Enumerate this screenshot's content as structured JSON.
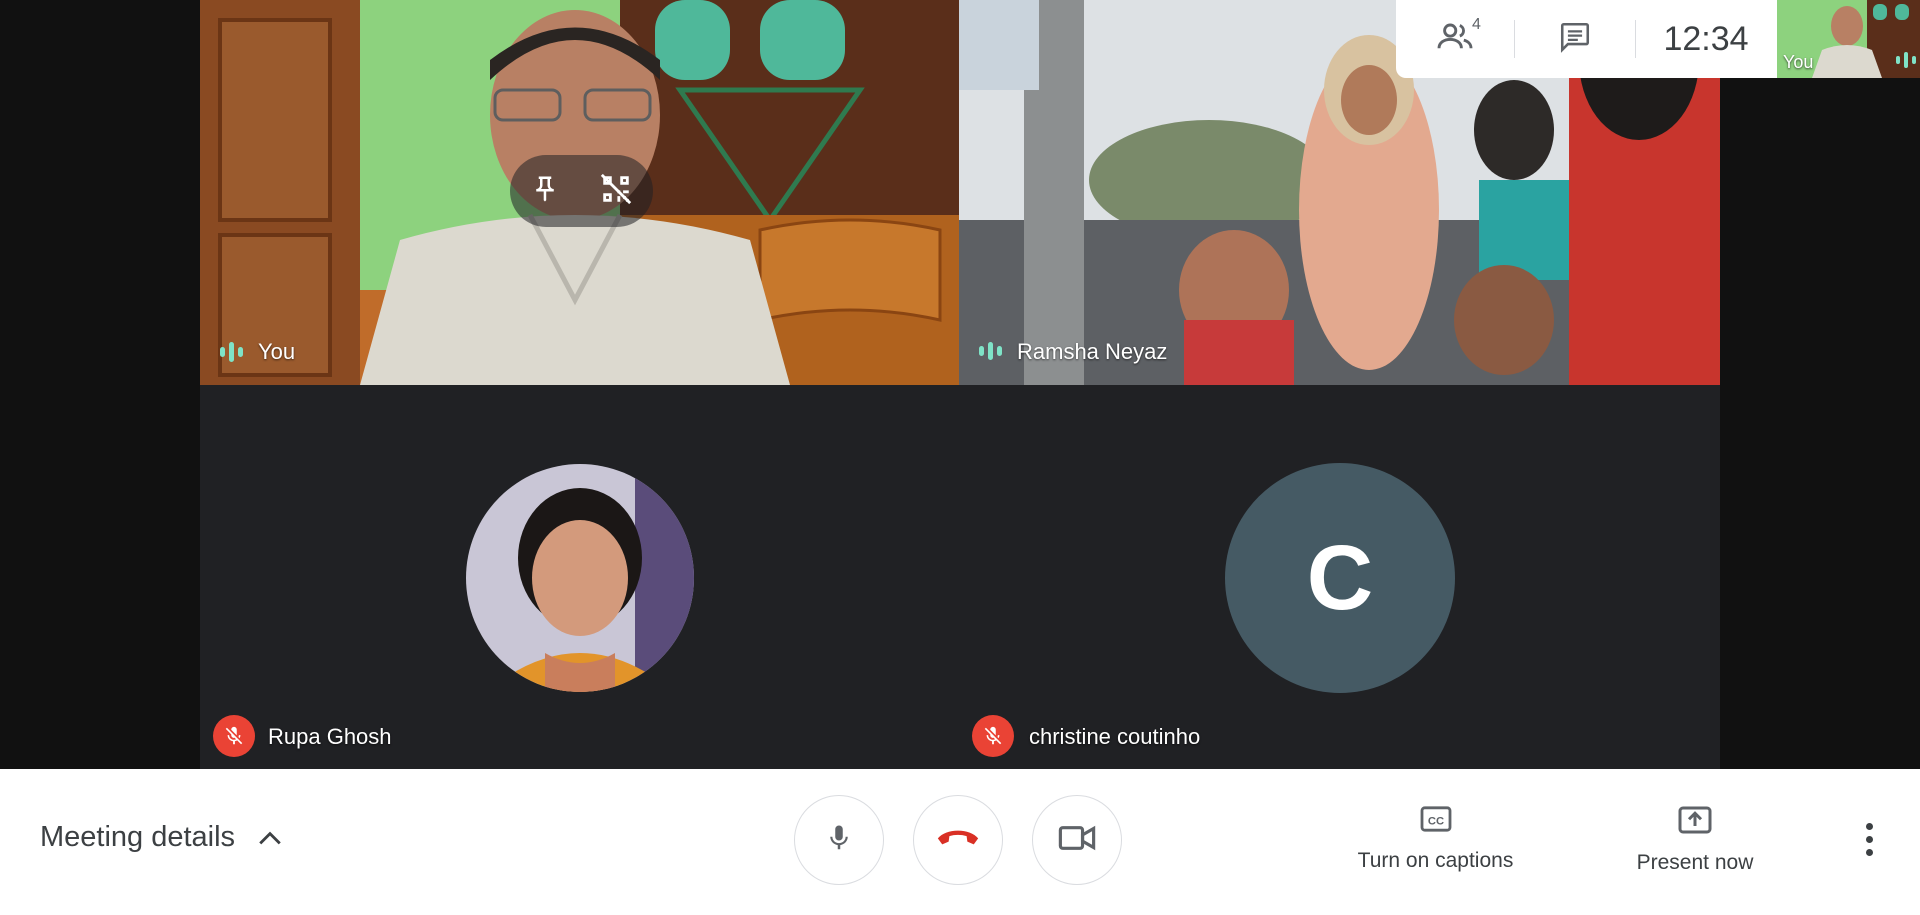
{
  "participants": {
    "self": {
      "name": "You"
    },
    "ramsha": {
      "name": "Ramsha Neyaz"
    },
    "rupa": {
      "name": "Rupa Ghosh"
    },
    "christine": {
      "name": "christine coutinho",
      "initial": "C",
      "avatar_color": "#455a64"
    }
  },
  "top_bar": {
    "participant_count": "4",
    "clock": "12:34",
    "self_label": "You"
  },
  "bottom_bar": {
    "meeting_details_label": "Meeting details",
    "captions_label": "Turn on captions",
    "present_label": "Present now"
  },
  "colors": {
    "background": "#202124",
    "mute_red": "#ea4335",
    "hangup_red": "#d93025",
    "speaking_teal": "#7fe3c7"
  }
}
